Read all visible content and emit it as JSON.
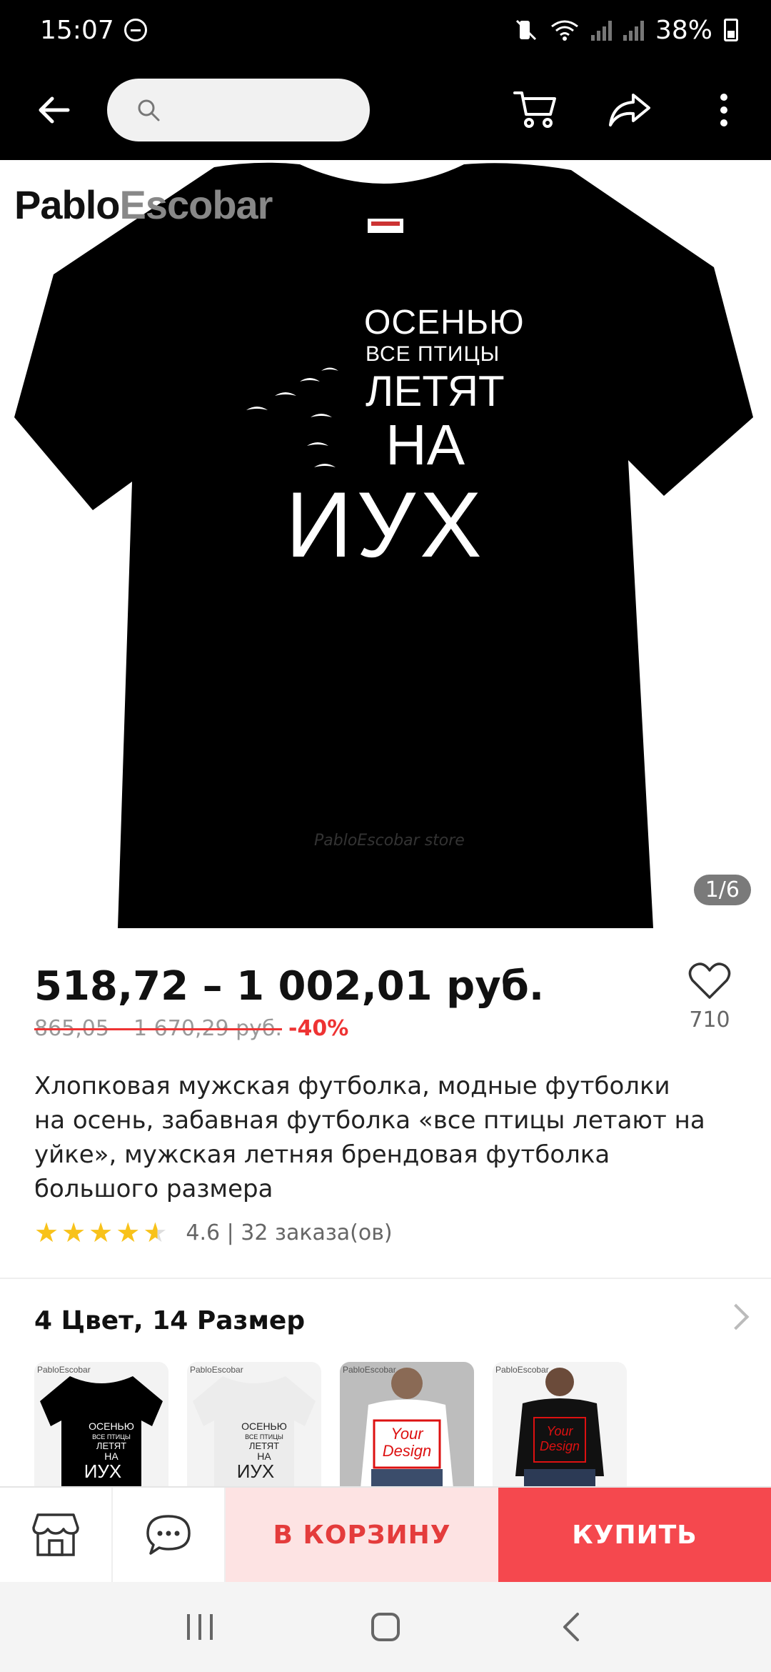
{
  "status_bar": {
    "time": "15:07",
    "battery": "38%",
    "icons": [
      "dnd-icon",
      "mute-icon",
      "wifi-icon",
      "signal-icon",
      "signal-icon",
      "battery-icon"
    ]
  },
  "app_bar": {
    "search": {
      "placeholder": ""
    },
    "icons": [
      "back-arrow-icon",
      "search-icon",
      "cart-icon",
      "share-icon",
      "more-vert-icon"
    ]
  },
  "product_image": {
    "brand_part1": "Pablo",
    "brand_part2": "Escobar",
    "shirt_lines": [
      "ОСЕНЬЮ",
      "ВСЕ ПТИЦЫ",
      "ЛЕТЯТ",
      "НА",
      "ИУХ"
    ],
    "watermark": "PabloEscobar store",
    "counter": "1/6"
  },
  "price": {
    "current": "518,72 – 1 002,01 руб.",
    "old": "865,05 – 1 670,29 руб.",
    "discount": "-40%",
    "wishlist_count": "710"
  },
  "product": {
    "title": "Хлопковая мужская футболка, модные футболки на осень, забавная футболка «все птицы летают на уйке», мужская летняя брендовая футболка большого размера",
    "rating_value": 4.6,
    "rating_text": "4.6 | 32 заказа(ов)"
  },
  "variants": {
    "title": "4 Цвет, 14 Размер",
    "thumbs": [
      {
        "label": "PabloEscobar",
        "shirt_text": "ОСЕНЬЮ ВСЕ ПТИЦЫ ЛЕТЯТ НА ИУХ",
        "color": "#000000"
      },
      {
        "label": "PabloEscobar",
        "shirt_text": "ОСЕНЬЮ ВСЕ ПТИЦЫ ЛЕТЯТ НА ИУХ",
        "color": "#ececec"
      },
      {
        "label": "PabloEscobar",
        "shirt_text": "Your Design",
        "color": "#ffffff"
      },
      {
        "label": "PabloEscobar",
        "shirt_text": "Your Design",
        "color": "#111111"
      }
    ]
  },
  "bottom_bar": {
    "store_icon": "store-icon",
    "chat_icon": "chat-icon",
    "add_to_cart": "В КОРЗИНУ",
    "buy": "КУПИТЬ",
    "accent": "#f5484e"
  },
  "nav_bar": {
    "icons": [
      "recents-icon",
      "home-icon",
      "back-icon"
    ]
  }
}
